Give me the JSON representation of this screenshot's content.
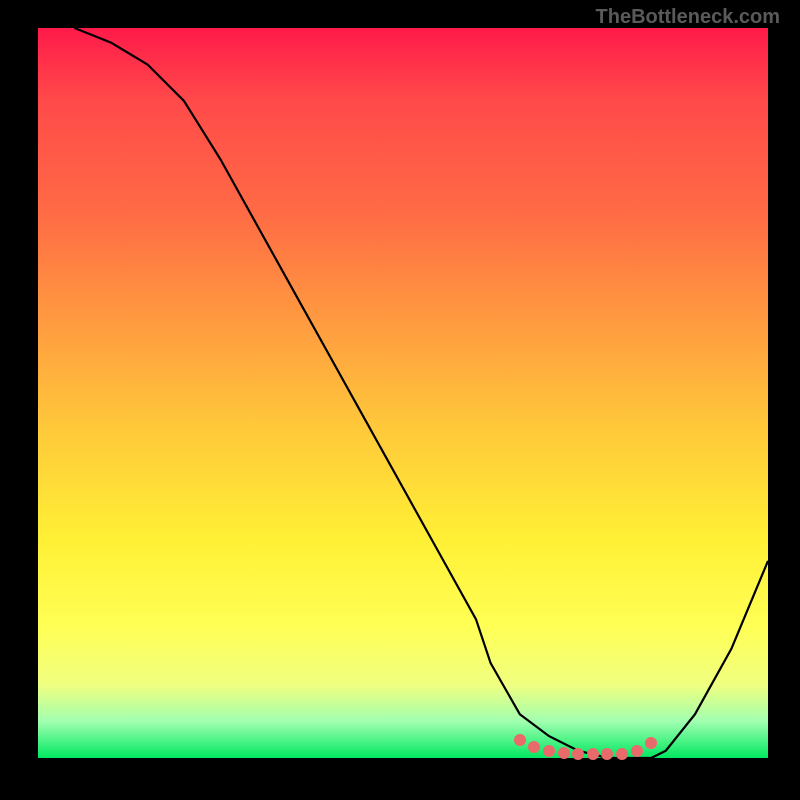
{
  "watermark": "TheBottleneck.com",
  "chart_data": {
    "type": "line",
    "title": "",
    "xlabel": "",
    "ylabel": "",
    "xlim": [
      0,
      100
    ],
    "ylim": [
      0,
      100
    ],
    "series": [
      {
        "name": "curve",
        "x": [
          5,
          10,
          15,
          20,
          25,
          30,
          35,
          40,
          45,
          50,
          55,
          60,
          62,
          66,
          70,
          74,
          78,
          82,
          84,
          86,
          90,
          95,
          100
        ],
        "y": [
          100,
          98,
          95,
          90,
          82,
          73,
          64,
          55,
          46,
          37,
          28,
          19,
          13,
          6,
          3,
          1,
          0,
          0,
          0,
          1,
          6,
          15,
          27
        ]
      }
    ],
    "markers": {
      "name": "bottom-cluster",
      "x": [
        66,
        68,
        70,
        72,
        74,
        76,
        78,
        80,
        82,
        84
      ],
      "y": [
        2.5,
        1.5,
        1.0,
        0.7,
        0.5,
        0.5,
        0.5,
        0.5,
        1.0,
        2.0
      ]
    },
    "gradient": {
      "top": "#ff1a4a",
      "mid": "#fff035",
      "bottom": "#00e860"
    }
  }
}
